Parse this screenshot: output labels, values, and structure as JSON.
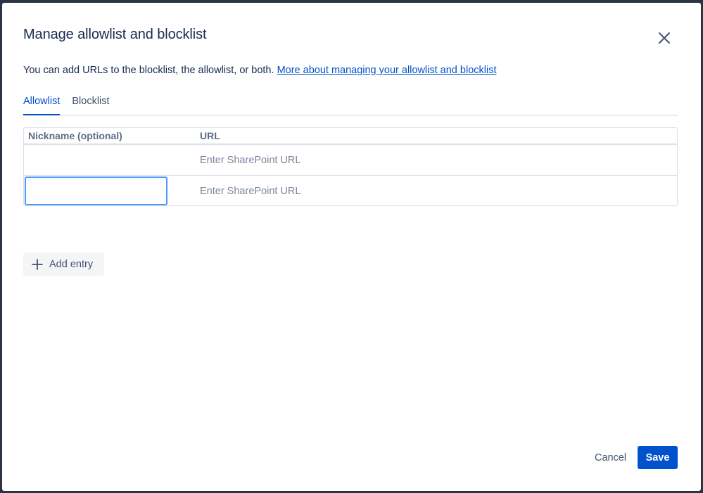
{
  "dialog": {
    "title": "Manage allowlist and blocklist",
    "description": "You can add URLs to the blocklist, the allowlist, or both.",
    "link_text": "More about managing your allowlist and blocklist"
  },
  "tabs": [
    {
      "label": "Allowlist",
      "active": true
    },
    {
      "label": "Blocklist",
      "active": false
    }
  ],
  "table": {
    "columns": [
      "Nickname (optional)",
      "URL"
    ],
    "rows": [
      {
        "nickname": "",
        "url": "",
        "url_placeholder": "Enter SharePoint URL",
        "nickname_focused": false
      },
      {
        "nickname": "",
        "url": "",
        "url_placeholder": "Enter SharePoint URL",
        "nickname_focused": true
      }
    ]
  },
  "actions": {
    "add_entry": "Add entry",
    "cancel": "Cancel",
    "save": "Save"
  },
  "colors": {
    "primary": "#0052cc",
    "focus_ring": "#4c9aff",
    "text": "#172b4d",
    "subtle_text": "#42526e"
  },
  "icons": {
    "close": "close-icon",
    "add": "plus-icon"
  }
}
